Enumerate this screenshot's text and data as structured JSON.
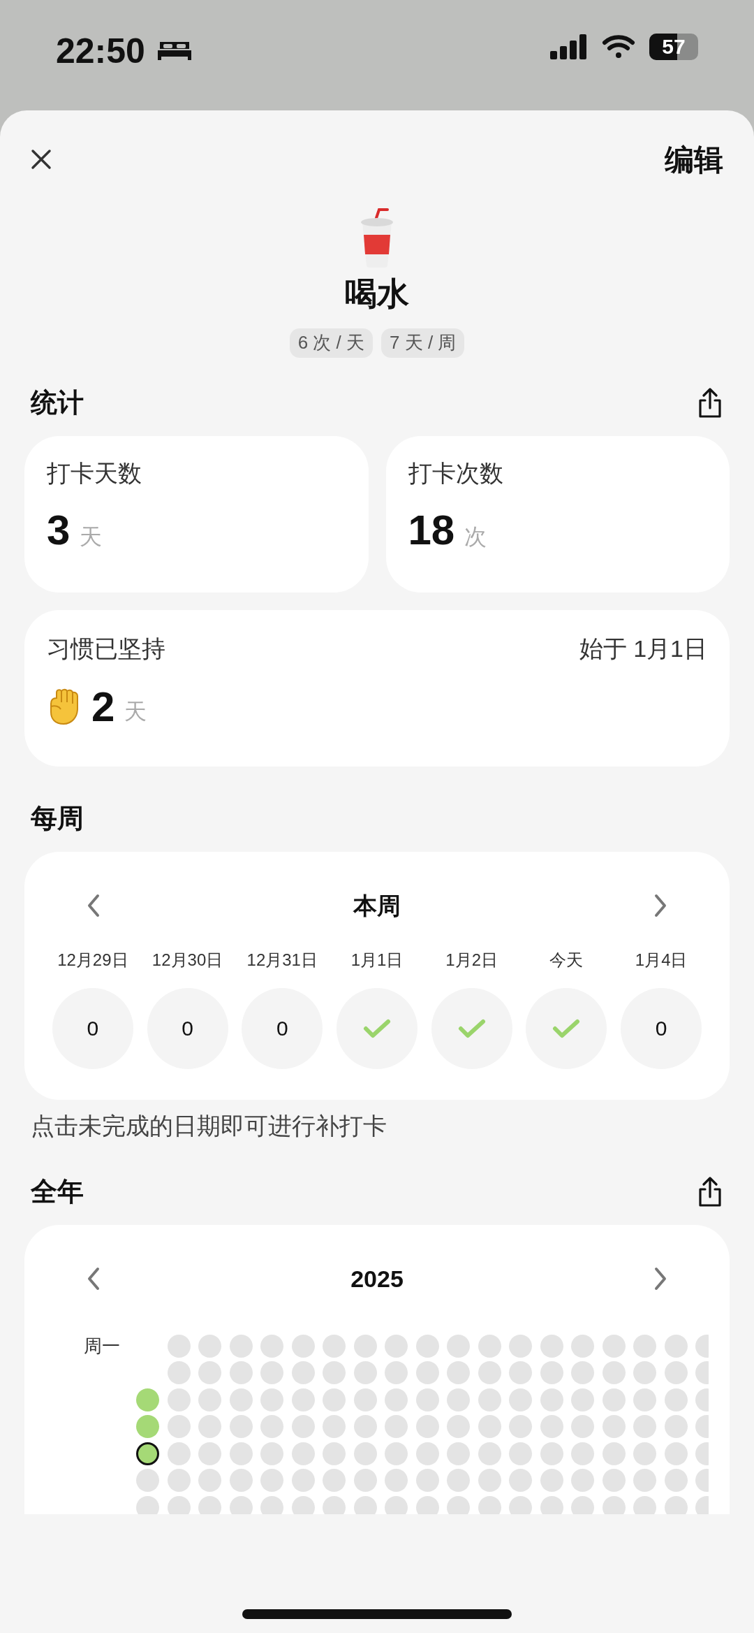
{
  "status_bar": {
    "time": "22:50",
    "battery": "57"
  },
  "header": {
    "edit": "编辑",
    "title": "喝水",
    "chips": [
      "6 次 / 天",
      "7 天 / 周"
    ]
  },
  "stats": {
    "title": "统计",
    "cards": [
      {
        "label": "打卡天数",
        "value": "3",
        "unit": "天"
      },
      {
        "label": "打卡次数",
        "value": "18",
        "unit": "次"
      }
    ],
    "streak": {
      "label": "习惯已坚持",
      "since": "始于 1月1日",
      "value": "2",
      "unit": "天"
    }
  },
  "weekly": {
    "title": "每周",
    "period": "本周",
    "days": [
      {
        "label": "12月29日",
        "done": false,
        "count": "0"
      },
      {
        "label": "12月30日",
        "done": false,
        "count": "0"
      },
      {
        "label": "12月31日",
        "done": false,
        "count": "0"
      },
      {
        "label": "1月1日",
        "done": true
      },
      {
        "label": "1月2日",
        "done": true
      },
      {
        "label": "今天",
        "done": true
      },
      {
        "label": "1月4日",
        "done": false,
        "count": "0"
      }
    ],
    "hint": "点击未完成的日期即可进行补打卡"
  },
  "yearly": {
    "title": "全年",
    "year": "2025",
    "row_label": "周一",
    "first_week": [
      {
        "kind": "blank"
      },
      {
        "kind": "blank"
      },
      {
        "kind": "dot",
        "done": true,
        "today": false
      },
      {
        "kind": "dot",
        "done": true,
        "today": false
      },
      {
        "kind": "dot",
        "done": true,
        "today": true
      },
      {
        "kind": "dot",
        "done": false,
        "today": false
      },
      {
        "kind": "dot",
        "done": false,
        "today": false
      }
    ]
  }
}
